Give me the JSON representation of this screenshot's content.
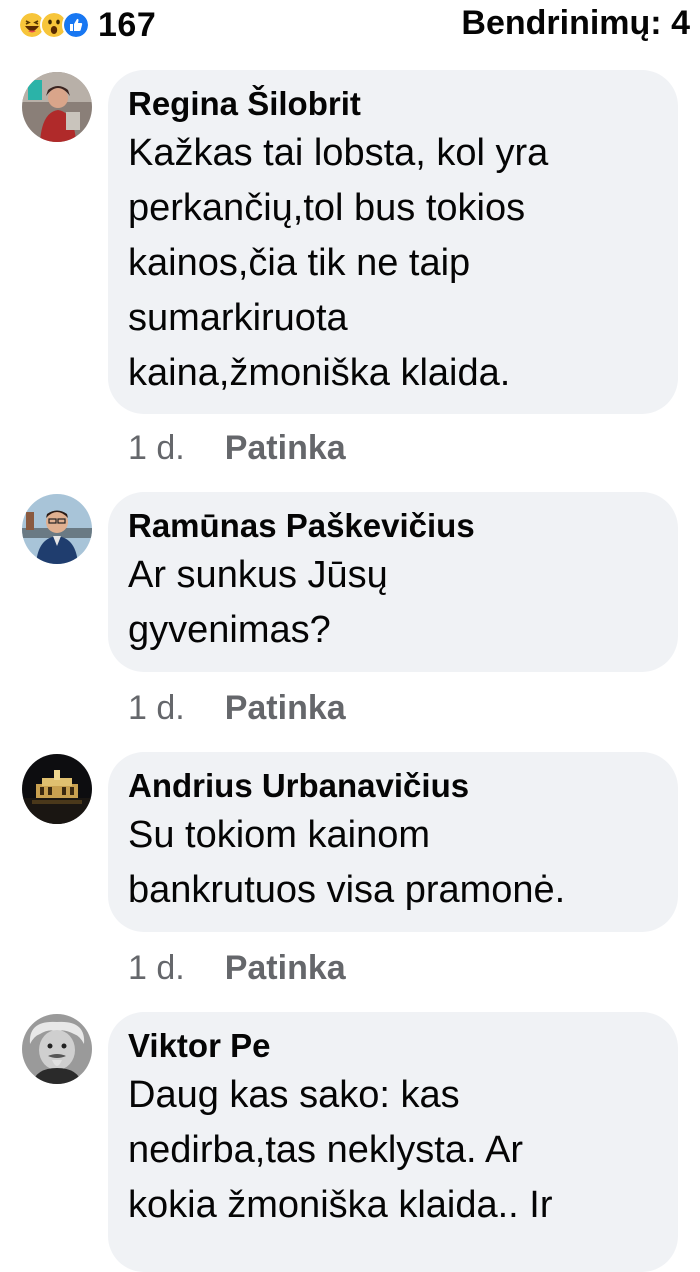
{
  "reactions": {
    "icons": [
      "haha-icon",
      "wow-icon",
      "like-icon"
    ],
    "count": "167"
  },
  "shares": {
    "label": "Bendrinimų:",
    "count": "4"
  },
  "comments": [
    {
      "author": "Regina Šilobrit",
      "text": "Kažkas tai lobsta, kol yra\nperkančių,tol bus tokios\nkainos,čia  tik ne taip\nsumarkiruota\nkaina,žmoniška klaida.",
      "time": "1 d.",
      "like": "Patinka"
    },
    {
      "author": "Ramūnas Paškevičius",
      "text": "Ar sunkus Jūsų\ngyvenimas?",
      "time": "1 d.",
      "like": "Patinka"
    },
    {
      "author": "Andrius Urbanavičius",
      "text": "Su tokiom kainom\nbankrutuos visa pramonė.",
      "time": "1 d.",
      "like": "Patinka"
    },
    {
      "author": "Viktor Pe",
      "text": "Daug kas sako: kas\nnedirba,tas neklysta. Ar\nkokia žmoniška klaida.. Ir",
      "time": "",
      "like": ""
    }
  ],
  "colors": {
    "bubble": "#f0f2f5",
    "meta": "#65676b",
    "like_blue": "#1877f2",
    "haha_yellow": "#f7c53a"
  }
}
